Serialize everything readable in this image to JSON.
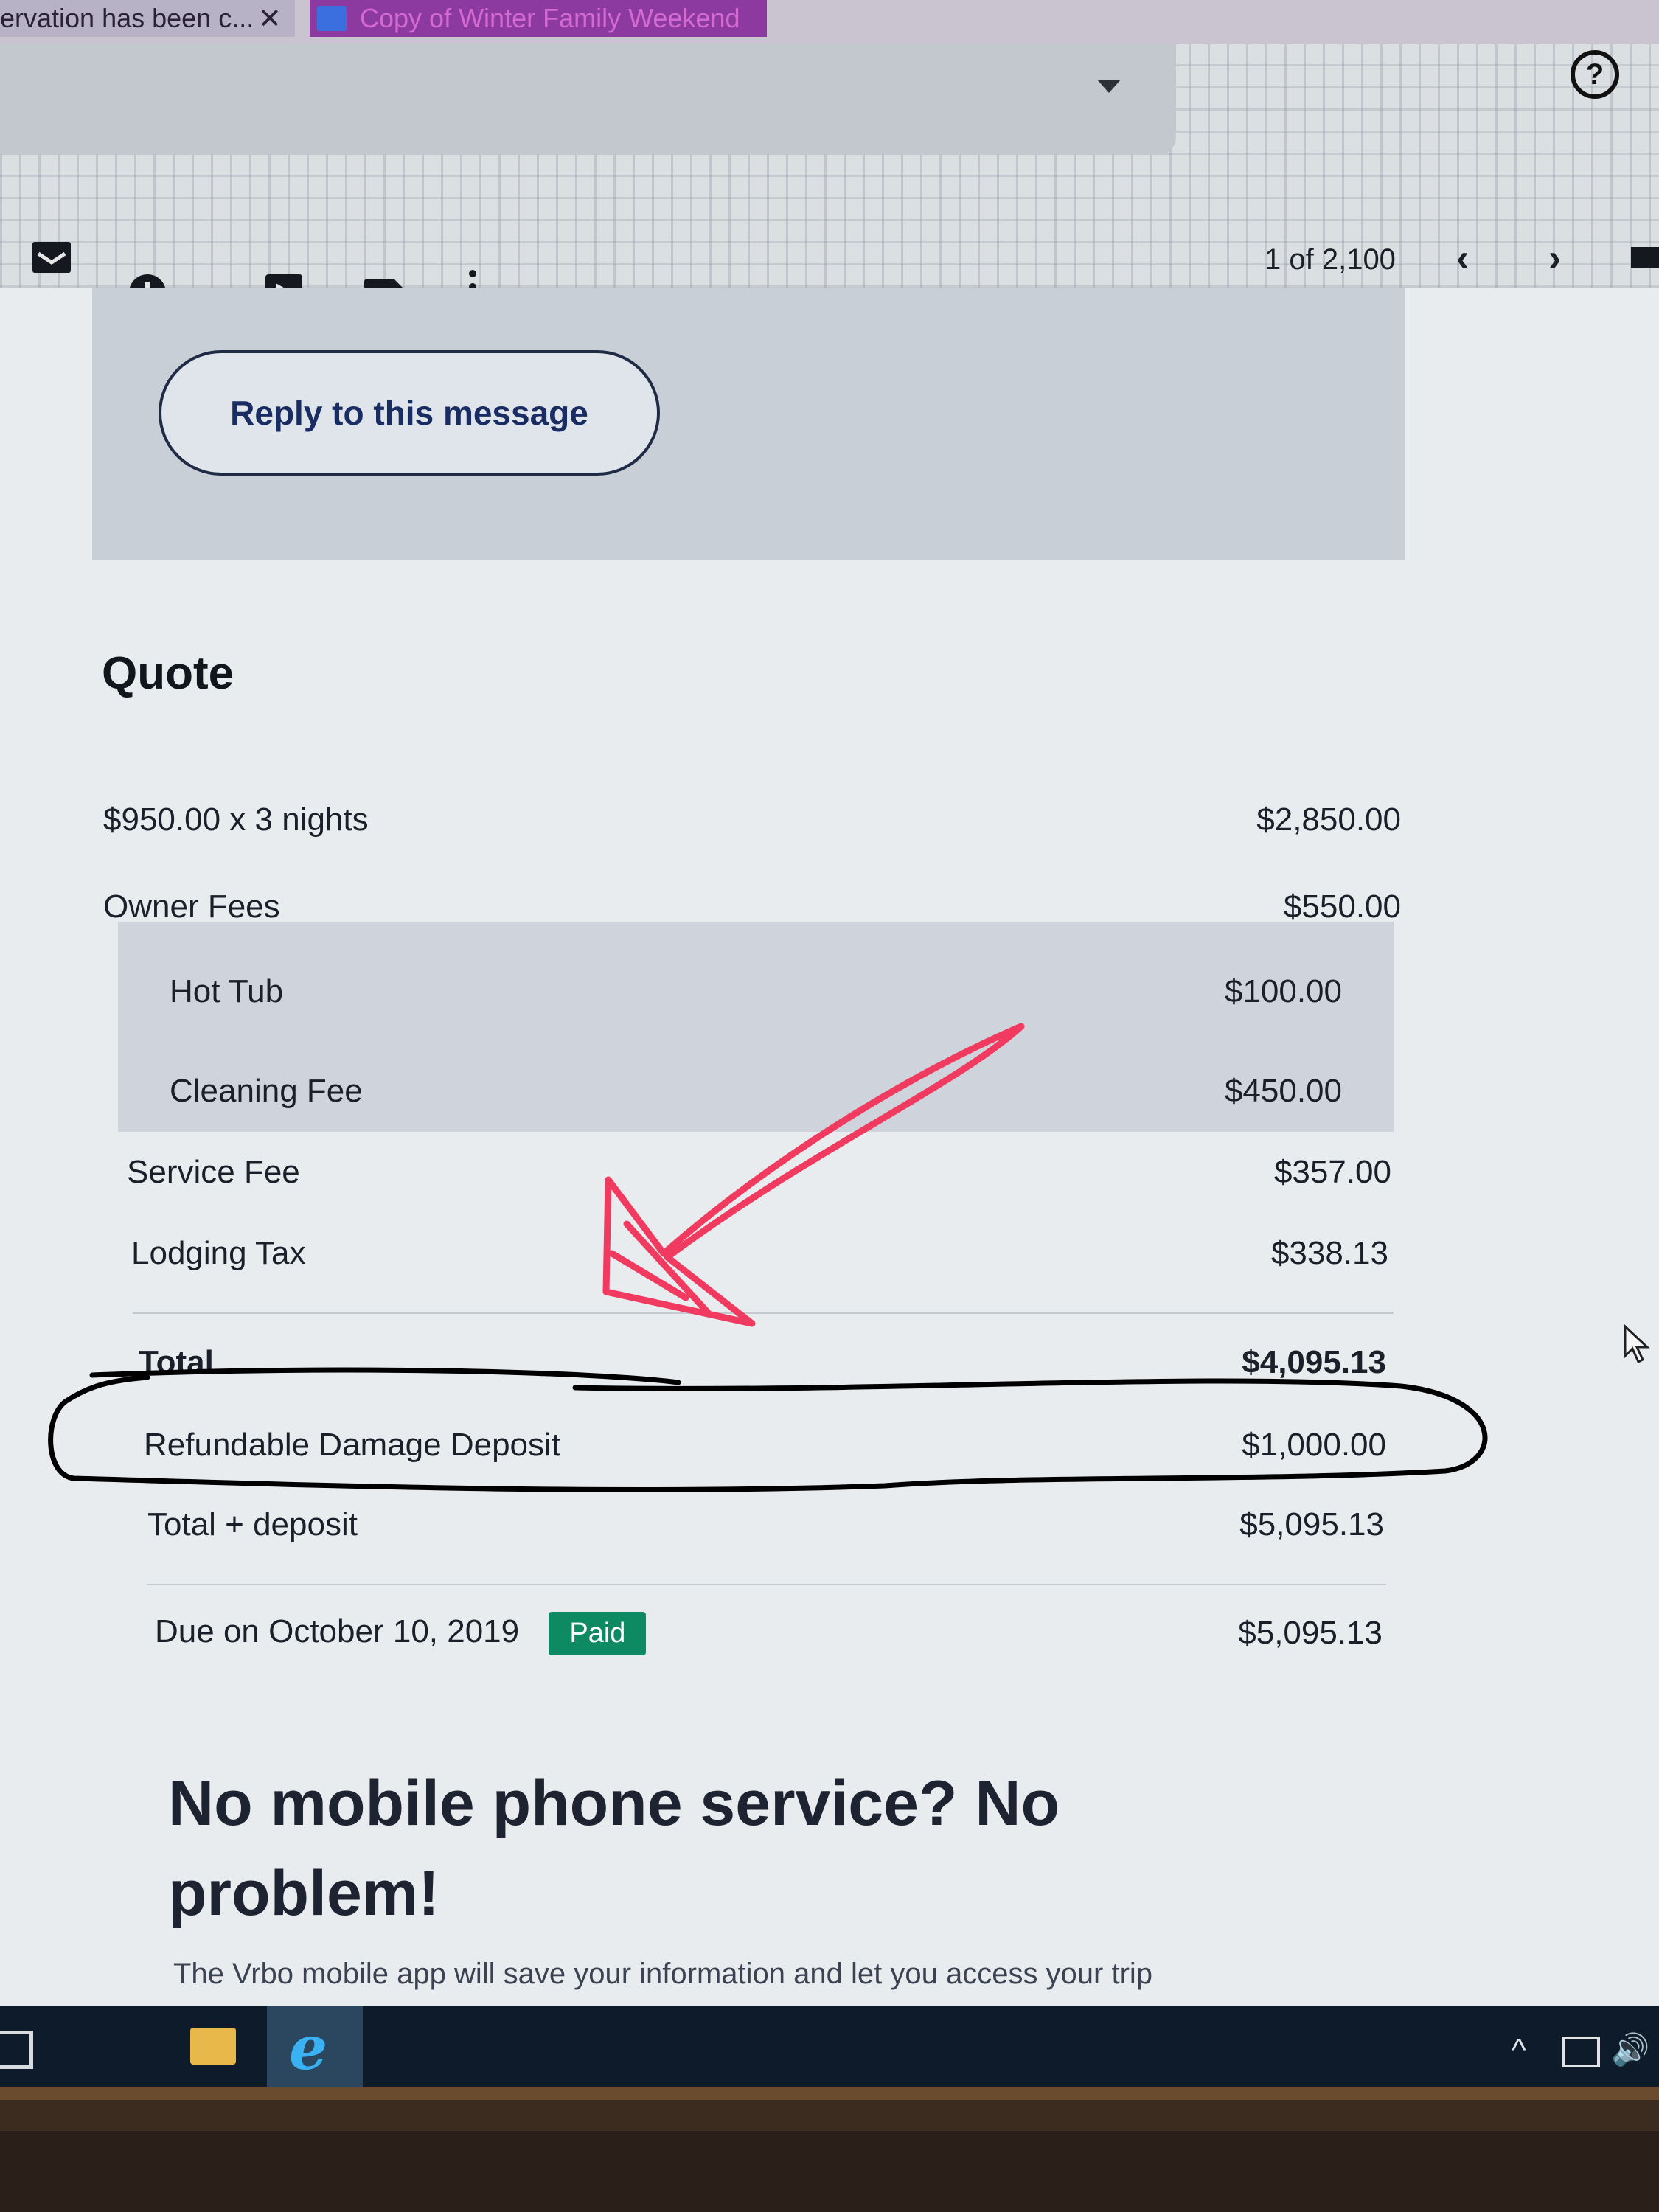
{
  "browser": {
    "tabs": [
      {
        "title": "ervation has been c...",
        "close": "✕"
      },
      {
        "title": "Copy of Winter Family Weekend"
      }
    ]
  },
  "gmail": {
    "pager": "1 of 2,100",
    "icons": [
      "archive-icon",
      "snooze-icon",
      "move-to-icon",
      "label-icon",
      "more-icon",
      "help-icon"
    ]
  },
  "email": {
    "reply_button": "Reply to this message",
    "quote": {
      "title": "Quote",
      "rows": [
        {
          "label": "$950.00 x 3 nights",
          "amount": "$2,850.00"
        },
        {
          "label": "Owner Fees",
          "amount": "$550.00"
        },
        {
          "label": "Hot Tub",
          "amount": "$100.00"
        },
        {
          "label": "Cleaning Fee",
          "amount": "$450.00"
        },
        {
          "label": "Service Fee",
          "amount": "$357.00"
        },
        {
          "label": "Lodging Tax",
          "amount": "$338.13"
        },
        {
          "label": "Total",
          "amount": "$4,095.13"
        },
        {
          "label": "Refundable Damage Deposit",
          "amount": "$1,000.00"
        },
        {
          "label": "Total + deposit",
          "amount": "$5,095.13"
        }
      ],
      "due": {
        "label": "Due on October 10, 2019",
        "badge": "Paid",
        "amount": "$5,095.13"
      }
    },
    "promo": {
      "title": "No mobile phone service? No problem!",
      "text": "The Vrbo mobile app will save your information and let you access your trip"
    }
  },
  "colors": {
    "paid_badge": "#0e8a63",
    "reply_text": "#1a2d63",
    "arrow_annotation": "#f03a5f",
    "circle_annotation": "#000000"
  }
}
